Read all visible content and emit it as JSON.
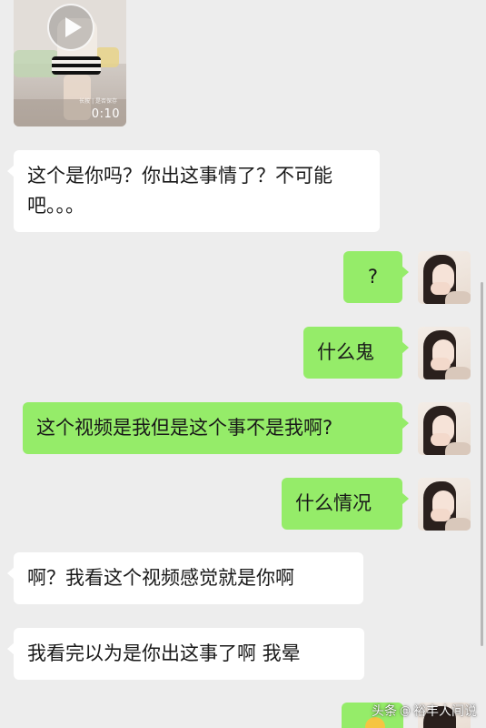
{
  "video": {
    "duration": "0:10",
    "small_caption": "长按 | 是否保存"
  },
  "messages": [
    {
      "side": "left",
      "text": "这个是你吗？你出这事情了？不可能吧。。。"
    },
    {
      "side": "right",
      "text": "?"
    },
    {
      "side": "right",
      "text": "什么鬼"
    },
    {
      "side": "right",
      "text": "这个视频是我但是这个事不是我啊?"
    },
    {
      "side": "right",
      "text": "什么情况"
    },
    {
      "side": "left",
      "text": "啊？我看这个视频感觉就是你啊"
    },
    {
      "side": "left",
      "text": "我看完以为是你出这事了啊 我晕"
    }
  ],
  "watermark": {
    "app": "头条",
    "at": "@",
    "author": "裕丰人间说"
  },
  "colors": {
    "background": "#ededed",
    "bubble_left": "#ffffff",
    "bubble_right": "#95ec69"
  }
}
